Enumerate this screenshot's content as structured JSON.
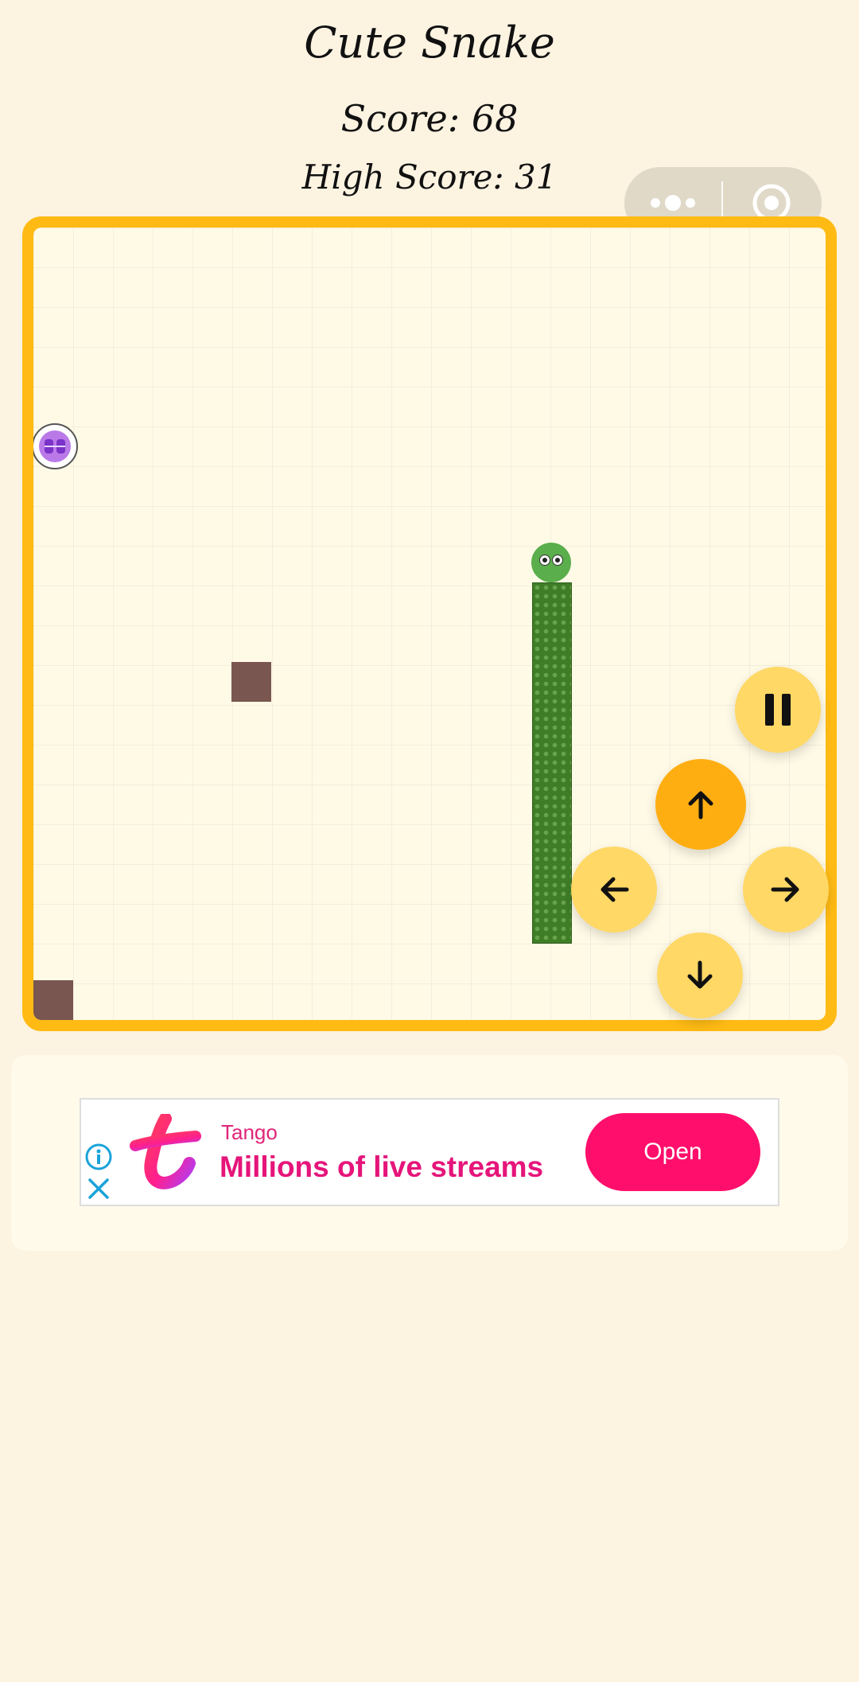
{
  "header": {
    "title": "Cute Snake",
    "score": "Score: 68",
    "high_score": "High Score: 31"
  },
  "capsule": {
    "more_icon": "more-dots-icon",
    "close_icon": "target-circle-icon"
  },
  "board": {
    "border_color": "#ffbb14",
    "snake_color": "#3f7e27",
    "obstacle_color": "#7a5650"
  },
  "controls": {
    "pause_icon": "pause-icon",
    "up_icon": "arrow-up-icon",
    "left_icon": "arrow-left-icon",
    "right_icon": "arrow-right-icon",
    "down_icon": "arrow-down-icon",
    "active_color": "#ffae12",
    "idle_color": "#ffd866"
  },
  "ad": {
    "brand": "Tango",
    "headline": "Millions of live streams",
    "cta": "Open",
    "cta_color": "#ff0f6b"
  }
}
